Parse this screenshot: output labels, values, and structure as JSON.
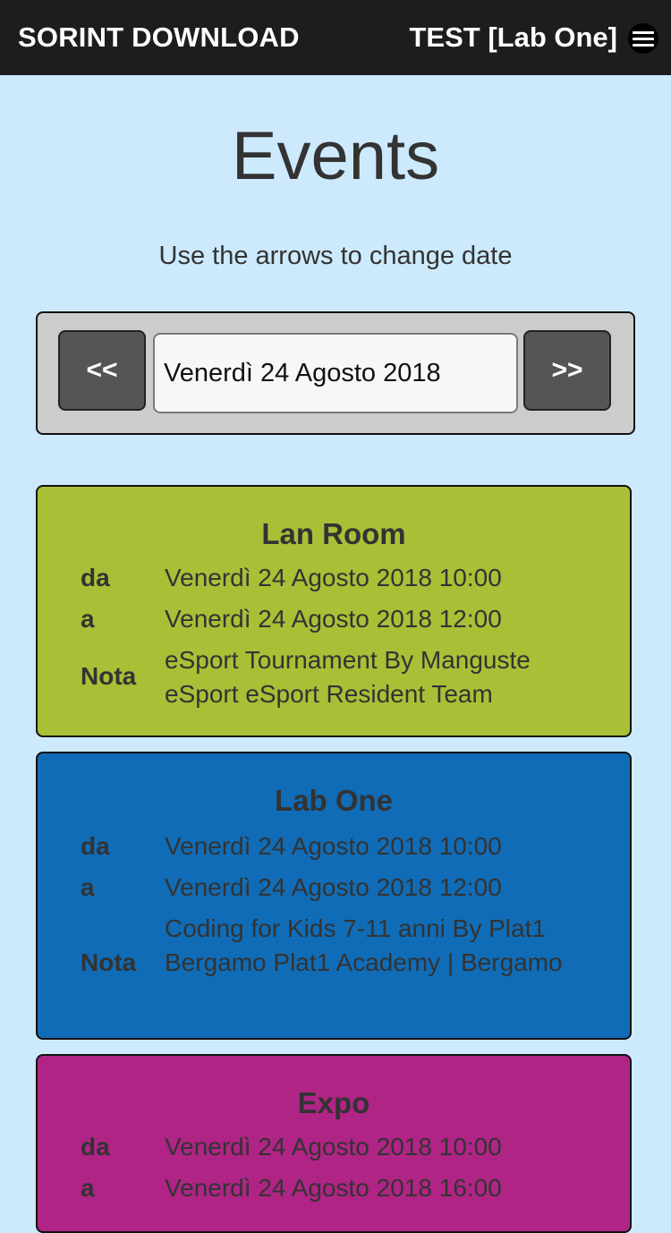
{
  "header": {
    "brand": "SORINT DOWNLOAD",
    "user": "TEST [Lab One]",
    "menu_icon": "hamburger-menu-icon"
  },
  "page": {
    "title": "Events",
    "subtitle": "Use the arrows to change date"
  },
  "date_nav": {
    "prev_label": "<<",
    "next_label": ">>",
    "current_date": "Venerdì 24 Agosto 2018"
  },
  "labels": {
    "from": "da",
    "to": "a",
    "note": "Nota"
  },
  "events": [
    {
      "name": "Lan Room",
      "from": "Venerdì 24 Agosto 2018 10:00",
      "to": "Venerdì 24 Agosto 2018 12:00",
      "note": "eSport Tournament By Manguste eSport eSport Resident Team",
      "color": "#a9bf36"
    },
    {
      "name": "Lab One",
      "from": "Venerdì 24 Agosto 2018 10:00",
      "to": "Venerdì 24 Agosto 2018 12:00",
      "note": "Coding for Kids 7-11 anni By Plat1 Bergamo Plat1 Academy | Bergamo",
      "color": "#106cb6"
    },
    {
      "name": "Expo",
      "from": "Venerdì 24 Agosto 2018 10:00",
      "to": "Venerdì 24 Agosto 2018 16:00",
      "color": "#b02486"
    }
  ],
  "colors": {
    "background": "#cdeafd",
    "topbar": "#1d1d1d",
    "nav_panel": "#cccccc",
    "nav_button": "#555555"
  }
}
